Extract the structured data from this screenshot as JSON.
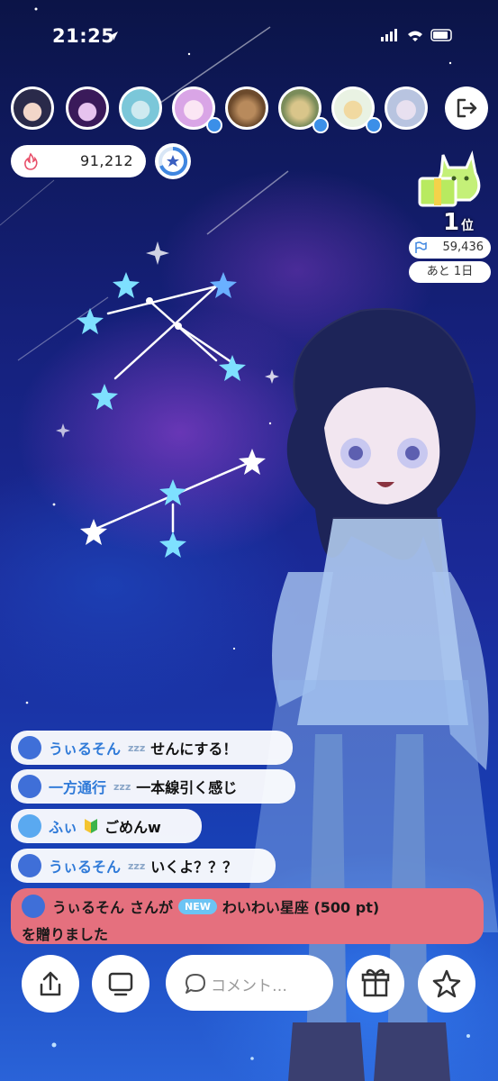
{
  "status_bar": {
    "time": "21:25"
  },
  "top": {
    "points": "91,212",
    "rank": "1",
    "rank_suffix": "位",
    "score": "59,436",
    "remaining": "あと 1日"
  },
  "chat": [
    {
      "name": "うぃるそん",
      "zz": "zzz",
      "text": "せんにする！",
      "avatar": "star-avatar"
    },
    {
      "name": "一方通行",
      "zz": "zzz",
      "text": "一本線引く感じ",
      "avatar": "star-avatar"
    },
    {
      "name": "ふぃ",
      "zz": "",
      "text": "ごめんw",
      "avatar": "star-avatar"
    },
    {
      "name": "うぃるそん",
      "zz": "zzz",
      "text": "いくよ？？？",
      "avatar": "star-avatar"
    }
  ],
  "gift": {
    "name": "うぃるそん",
    "pre": "さんが",
    "badge": "NEW",
    "item": "わいわい星座 (500 pt)",
    "post": "を贈りました"
  },
  "comment": {
    "placeholder": "コメント…"
  },
  "colors": {
    "accent": "#2f7ad8",
    "gift_bg": "#e5707e",
    "new_badge": "#6cc4f4"
  }
}
